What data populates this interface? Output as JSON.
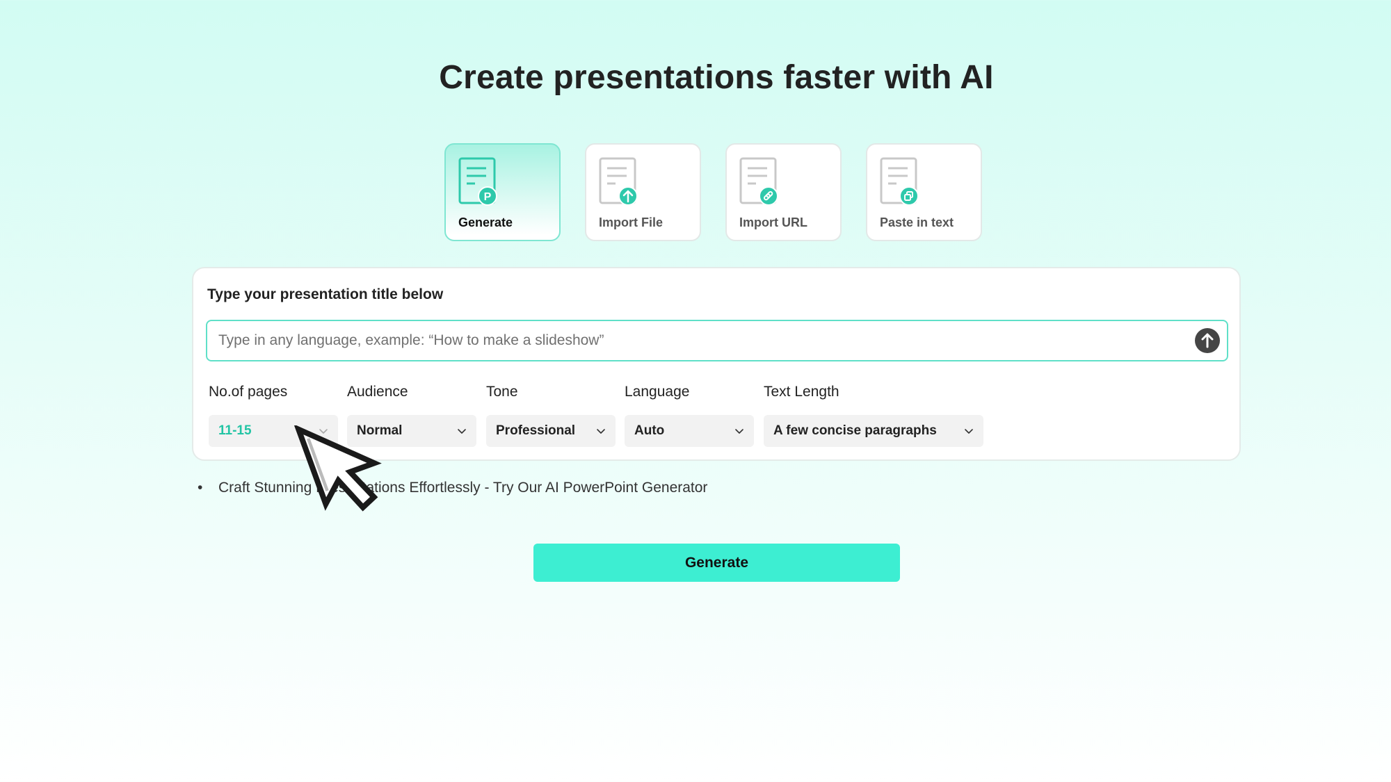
{
  "page": {
    "title": "Create presentations faster with AI"
  },
  "modes": [
    {
      "label": "Generate",
      "icon": "document-p-icon",
      "active": true
    },
    {
      "label": "Import File",
      "icon": "document-upload-icon",
      "active": false
    },
    {
      "label": "Import URL",
      "icon": "document-link-icon",
      "active": false
    },
    {
      "label": "Paste in text",
      "icon": "document-copy-icon",
      "active": false
    }
  ],
  "card": {
    "heading": "Type your presentation title below",
    "input_placeholder": "Type in any language, example: “How to make a slideshow”",
    "input_value": ""
  },
  "options": {
    "pages": {
      "label": "No.of pages",
      "value": "11-15"
    },
    "audience": {
      "label": "Audience",
      "value": "Normal"
    },
    "tone": {
      "label": "Tone",
      "value": "Professional"
    },
    "language": {
      "label": "Language",
      "value": "Auto"
    },
    "text_length": {
      "label": "Text Length",
      "value": "A few concise paragraphs"
    }
  },
  "tip": {
    "bullet": "•",
    "text": "Craft Stunning Presentations Effortlessly - Try Our AI PowerPoint Generator"
  },
  "actions": {
    "generate_label": "Generate"
  },
  "colors": {
    "accent": "#3deed2",
    "accent_dark": "#22c4a4",
    "input_border": "#5fe0c8",
    "arrow_button": "#454545"
  }
}
